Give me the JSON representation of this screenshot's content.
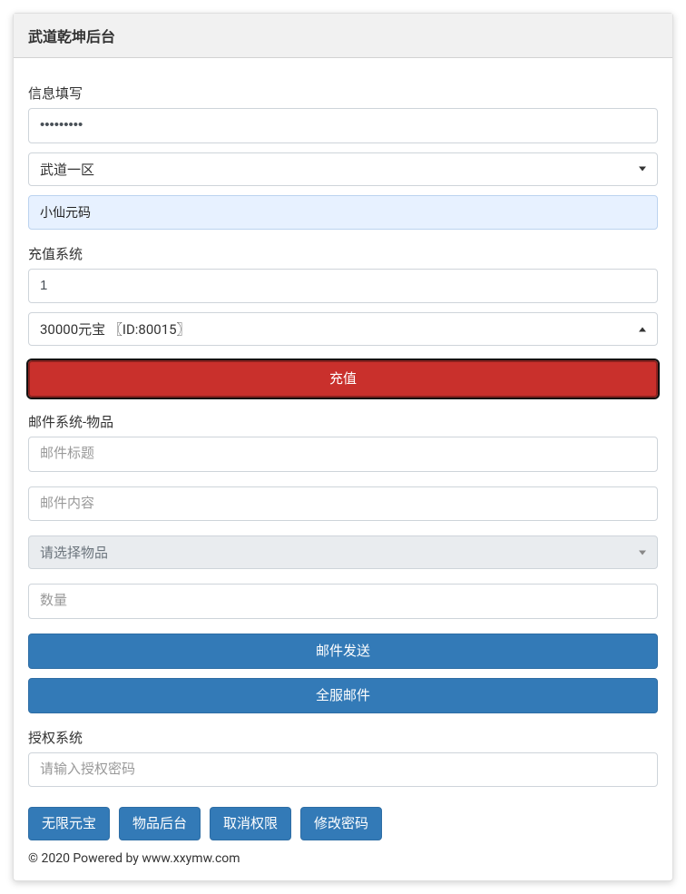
{
  "header": {
    "title": "武道乾坤后台"
  },
  "info": {
    "label": "信息填写",
    "password_value": "•••••••••",
    "server_selected": "武道一区",
    "role_selected": "小仙元码"
  },
  "recharge": {
    "label": "充值系统",
    "amount_value": "1",
    "item_selected": "30000元宝 〖ID:80015〗",
    "submit_label": "充值"
  },
  "mail": {
    "label": "邮件系统-物品",
    "title_placeholder": "邮件标题",
    "content_placeholder": "邮件内容",
    "item_placeholder": "请选择物品",
    "qty_placeholder": "数量",
    "send_label": "邮件发送",
    "broadcast_label": "全服邮件"
  },
  "auth": {
    "label": "授权系统",
    "password_placeholder": "请输入授权密码",
    "buttons": {
      "unlimited_gold": "无限元宝",
      "item_backend": "物品后台",
      "revoke": "取消权限",
      "change_pw": "修改密码"
    }
  },
  "footer": {
    "text": "© 2020 Powered by www.xxymw.com"
  }
}
